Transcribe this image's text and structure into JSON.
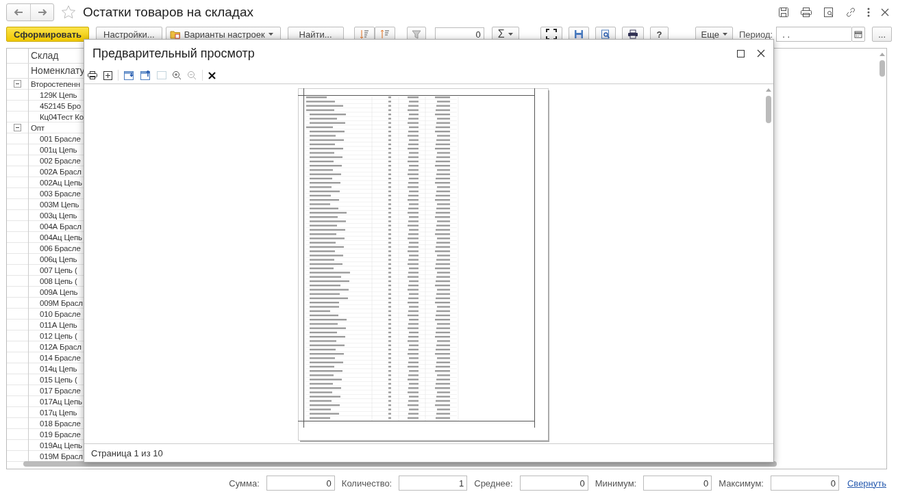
{
  "window": {
    "title": "Остатки товаров на складах"
  },
  "toolbar": {
    "generate": "Сформировать",
    "settings": "Настройки...",
    "variants": "Варианты настроек",
    "find": "Найти...",
    "counter": "0",
    "sum": "Σ",
    "help": "?",
    "more": "Еще",
    "period_label": "Период:",
    "period_value": ". .",
    "ellipsis": "..."
  },
  "report": {
    "columns": [
      "Склад",
      "Номенклату"
    ],
    "groups": [
      {
        "label": "Второстепенн",
        "expanded": true,
        "children": [
          {
            "label": "129К Цепь"
          },
          {
            "label": "452145 Бро"
          },
          {
            "label": "Кц04Тест Ко"
          }
        ]
      },
      {
        "label": "Опт",
        "expanded": true,
        "children": [
          {
            "label": "001 Брасле"
          },
          {
            "label": "001ц Цепь"
          },
          {
            "label": "002 Брасле"
          },
          {
            "label": "002А Брасл"
          },
          {
            "label": "002Ац Цепь"
          },
          {
            "label": "003 Брасле"
          },
          {
            "label": "003М Цепь"
          },
          {
            "label": "003ц Цепь"
          },
          {
            "label": "004А Брасл"
          },
          {
            "label": "004Ац Цепь"
          },
          {
            "label": "006 Брасле"
          },
          {
            "label": "006ц Цепь"
          },
          {
            "label": "007 Цепь ("
          },
          {
            "label": "008 Цепь ("
          },
          {
            "label": "009А Цепь"
          },
          {
            "label": "009М Брасл"
          },
          {
            "label": "010 Брасле"
          },
          {
            "label": "011А Цепь"
          },
          {
            "label": "012 Цепь ("
          },
          {
            "label": "012А Брасл"
          },
          {
            "label": "014 Брасле"
          },
          {
            "label": "014ц Цепь"
          },
          {
            "label": "015 Цепь ("
          },
          {
            "label": "017 Брасле"
          },
          {
            "label": "017Ац Цепь"
          },
          {
            "label": "017ц Цепь"
          },
          {
            "label": "018 Брасле"
          },
          {
            "label": "019 Брасле"
          },
          {
            "label": "019Ац Цепь"
          },
          {
            "label": "019М Брасл"
          }
        ]
      }
    ]
  },
  "preview": {
    "title": "Предварительный просмотр",
    "page_info": "Страница 1 из 10"
  },
  "summary": {
    "fields": [
      {
        "label": "Сумма:",
        "value": "0"
      },
      {
        "label": "Количество:",
        "value": "1"
      },
      {
        "label": "Среднее:",
        "value": "0"
      },
      {
        "label": "Минимум:",
        "value": "0"
      },
      {
        "label": "Максимум:",
        "value": "0"
      }
    ],
    "collapse_link": "Свернуть"
  }
}
